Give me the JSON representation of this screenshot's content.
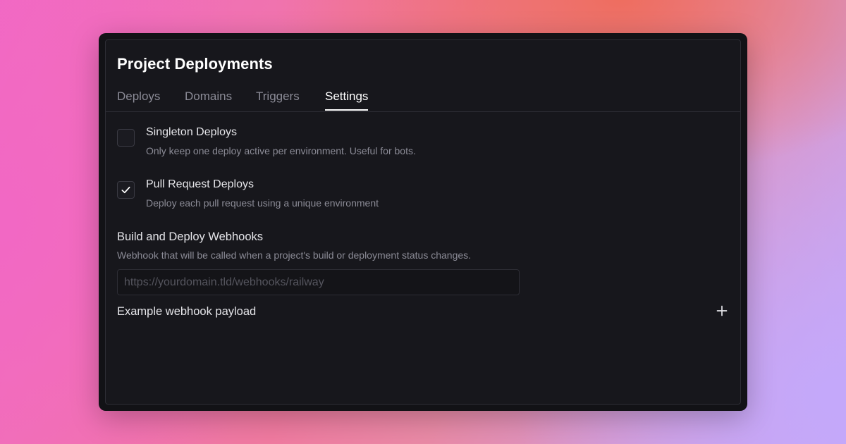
{
  "panel": {
    "title": "Project Deployments"
  },
  "tabs": [
    {
      "label": "Deploys",
      "active": false
    },
    {
      "label": "Domains",
      "active": false
    },
    {
      "label": "Triggers",
      "active": false
    },
    {
      "label": "Settings",
      "active": true
    }
  ],
  "settings": {
    "singleton": {
      "title": "Singleton Deploys",
      "description": "Only keep one deploy active per environment. Useful for bots.",
      "checked": false
    },
    "pull_request": {
      "title": "Pull Request Deploys",
      "description": "Deploy each pull request using a unique environment",
      "checked": true
    },
    "webhooks": {
      "title": "Build and Deploy Webhooks",
      "description": "Webhook that will be called when a project's build or deployment status changes.",
      "value": "",
      "placeholder": "https://yourdomain.tld/webhooks/railway"
    },
    "example_payload": {
      "label": "Example webhook payload",
      "icon": "plus-icon"
    }
  },
  "colors": {
    "background_pink": "#f169c4",
    "background_coral": "#ee6c5c",
    "background_lavender": "#c4a8fa",
    "window": "#121216",
    "panel": "#17171c",
    "border": "#2d2d35",
    "text_primary": "#ffffff",
    "text_muted": "#8b8b96"
  }
}
